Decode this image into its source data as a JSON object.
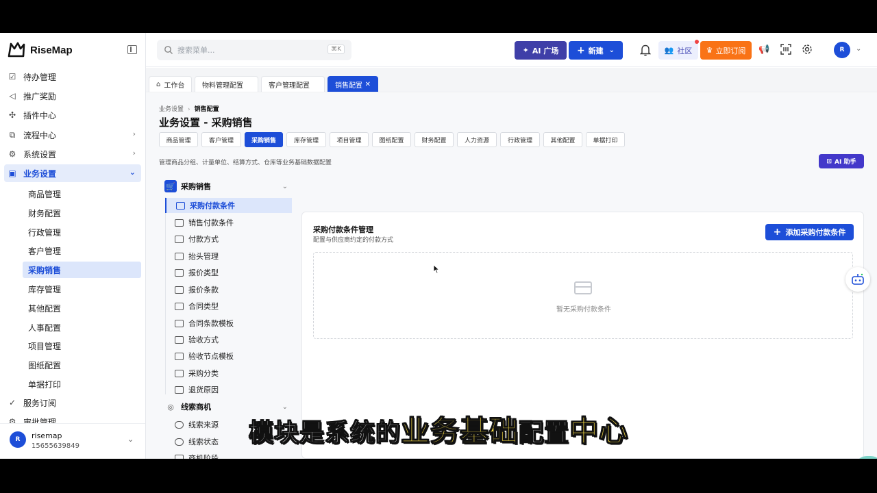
{
  "app": {
    "name": "RiseMap"
  },
  "sidebar": {
    "items": [
      {
        "label": "待办管理",
        "icon": "checklist-icon",
        "glyph": "☑"
      },
      {
        "label": "推广奖励",
        "icon": "megaphone-icon",
        "glyph": "◁"
      },
      {
        "label": "插件中心",
        "icon": "puzzle-icon",
        "glyph": "✣"
      },
      {
        "label": "流程中心",
        "icon": "flow-icon",
        "glyph": "⧉"
      },
      {
        "label": "系统设置",
        "icon": "gear-icon",
        "glyph": "⚙"
      },
      {
        "label": "业务设置",
        "icon": "briefcase-icon",
        "glyph": "▣"
      }
    ],
    "business_sub": [
      "商品管理",
      "财务配置",
      "行政管理",
      "客户管理",
      "采购销售",
      "库存管理",
      "其他配置",
      "人事配置",
      "项目管理",
      "图纸配置",
      "单据打印"
    ],
    "service": {
      "label": "服务订阅",
      "icon": "check-circle-icon"
    },
    "cut_item": {
      "label": "审批管理"
    },
    "user": {
      "avatar": "R",
      "name": "risemap",
      "phone": "15655639849"
    }
  },
  "header": {
    "search_placeholder": "搜索菜单...",
    "search_shortcut": "⌘K",
    "ai_plaza": "AI 广场",
    "new": "新建",
    "community": "社区",
    "subscribe": "立即订阅",
    "avatar": "R"
  },
  "page_tabs": [
    {
      "label": "工作台",
      "icon": "home-icon"
    },
    {
      "label": "物料管理配置"
    },
    {
      "label": "客户管理配置"
    },
    {
      "label": "销售配置",
      "active": true
    }
  ],
  "content": {
    "breadcrumb_parent": "业务设置",
    "breadcrumb_current": "销售配置",
    "title": "业务设置 - 采购销售",
    "tabs": [
      "商品管理",
      "客户管理",
      "采购销售",
      "库存管理",
      "项目管理",
      "图纸配置",
      "财务配置",
      "人力资源",
      "行政管理",
      "其他配置",
      "单据打印"
    ],
    "active_tab": "采购销售",
    "description": "管理商品分组、计量单位、结算方式、仓库等业务基础数据配置",
    "ai_helper": "AI 助手"
  },
  "config_menu": {
    "group1": "采购销售",
    "items": [
      "采购付款条件",
      "销售付款条件",
      "付款方式",
      "抬头管理",
      "报价类型",
      "报价条款",
      "合同类型",
      "合同条款模板",
      "验收方式",
      "验收节点模板",
      "采购分类",
      "退货原因"
    ],
    "group2": "线索商机",
    "group2_items": [
      "线索来源",
      "线索状态"
    ],
    "group2_cut": "商机阶段"
  },
  "panel": {
    "title": "采购付款条件管理",
    "subtitle": "配置与供应商约定的付款方式",
    "add_button": "添加采购付款条件",
    "empty_text": "暂无采购付款条件"
  },
  "caption": {
    "p1": "模块是系统的",
    "h1": "业务基础",
    "p2": "配置",
    "h2": "中心"
  },
  "colors": {
    "primary": "#1d4ed8",
    "ai": "#3f3fa8",
    "subscribe": "#f97316",
    "highlight": "#fde047"
  }
}
